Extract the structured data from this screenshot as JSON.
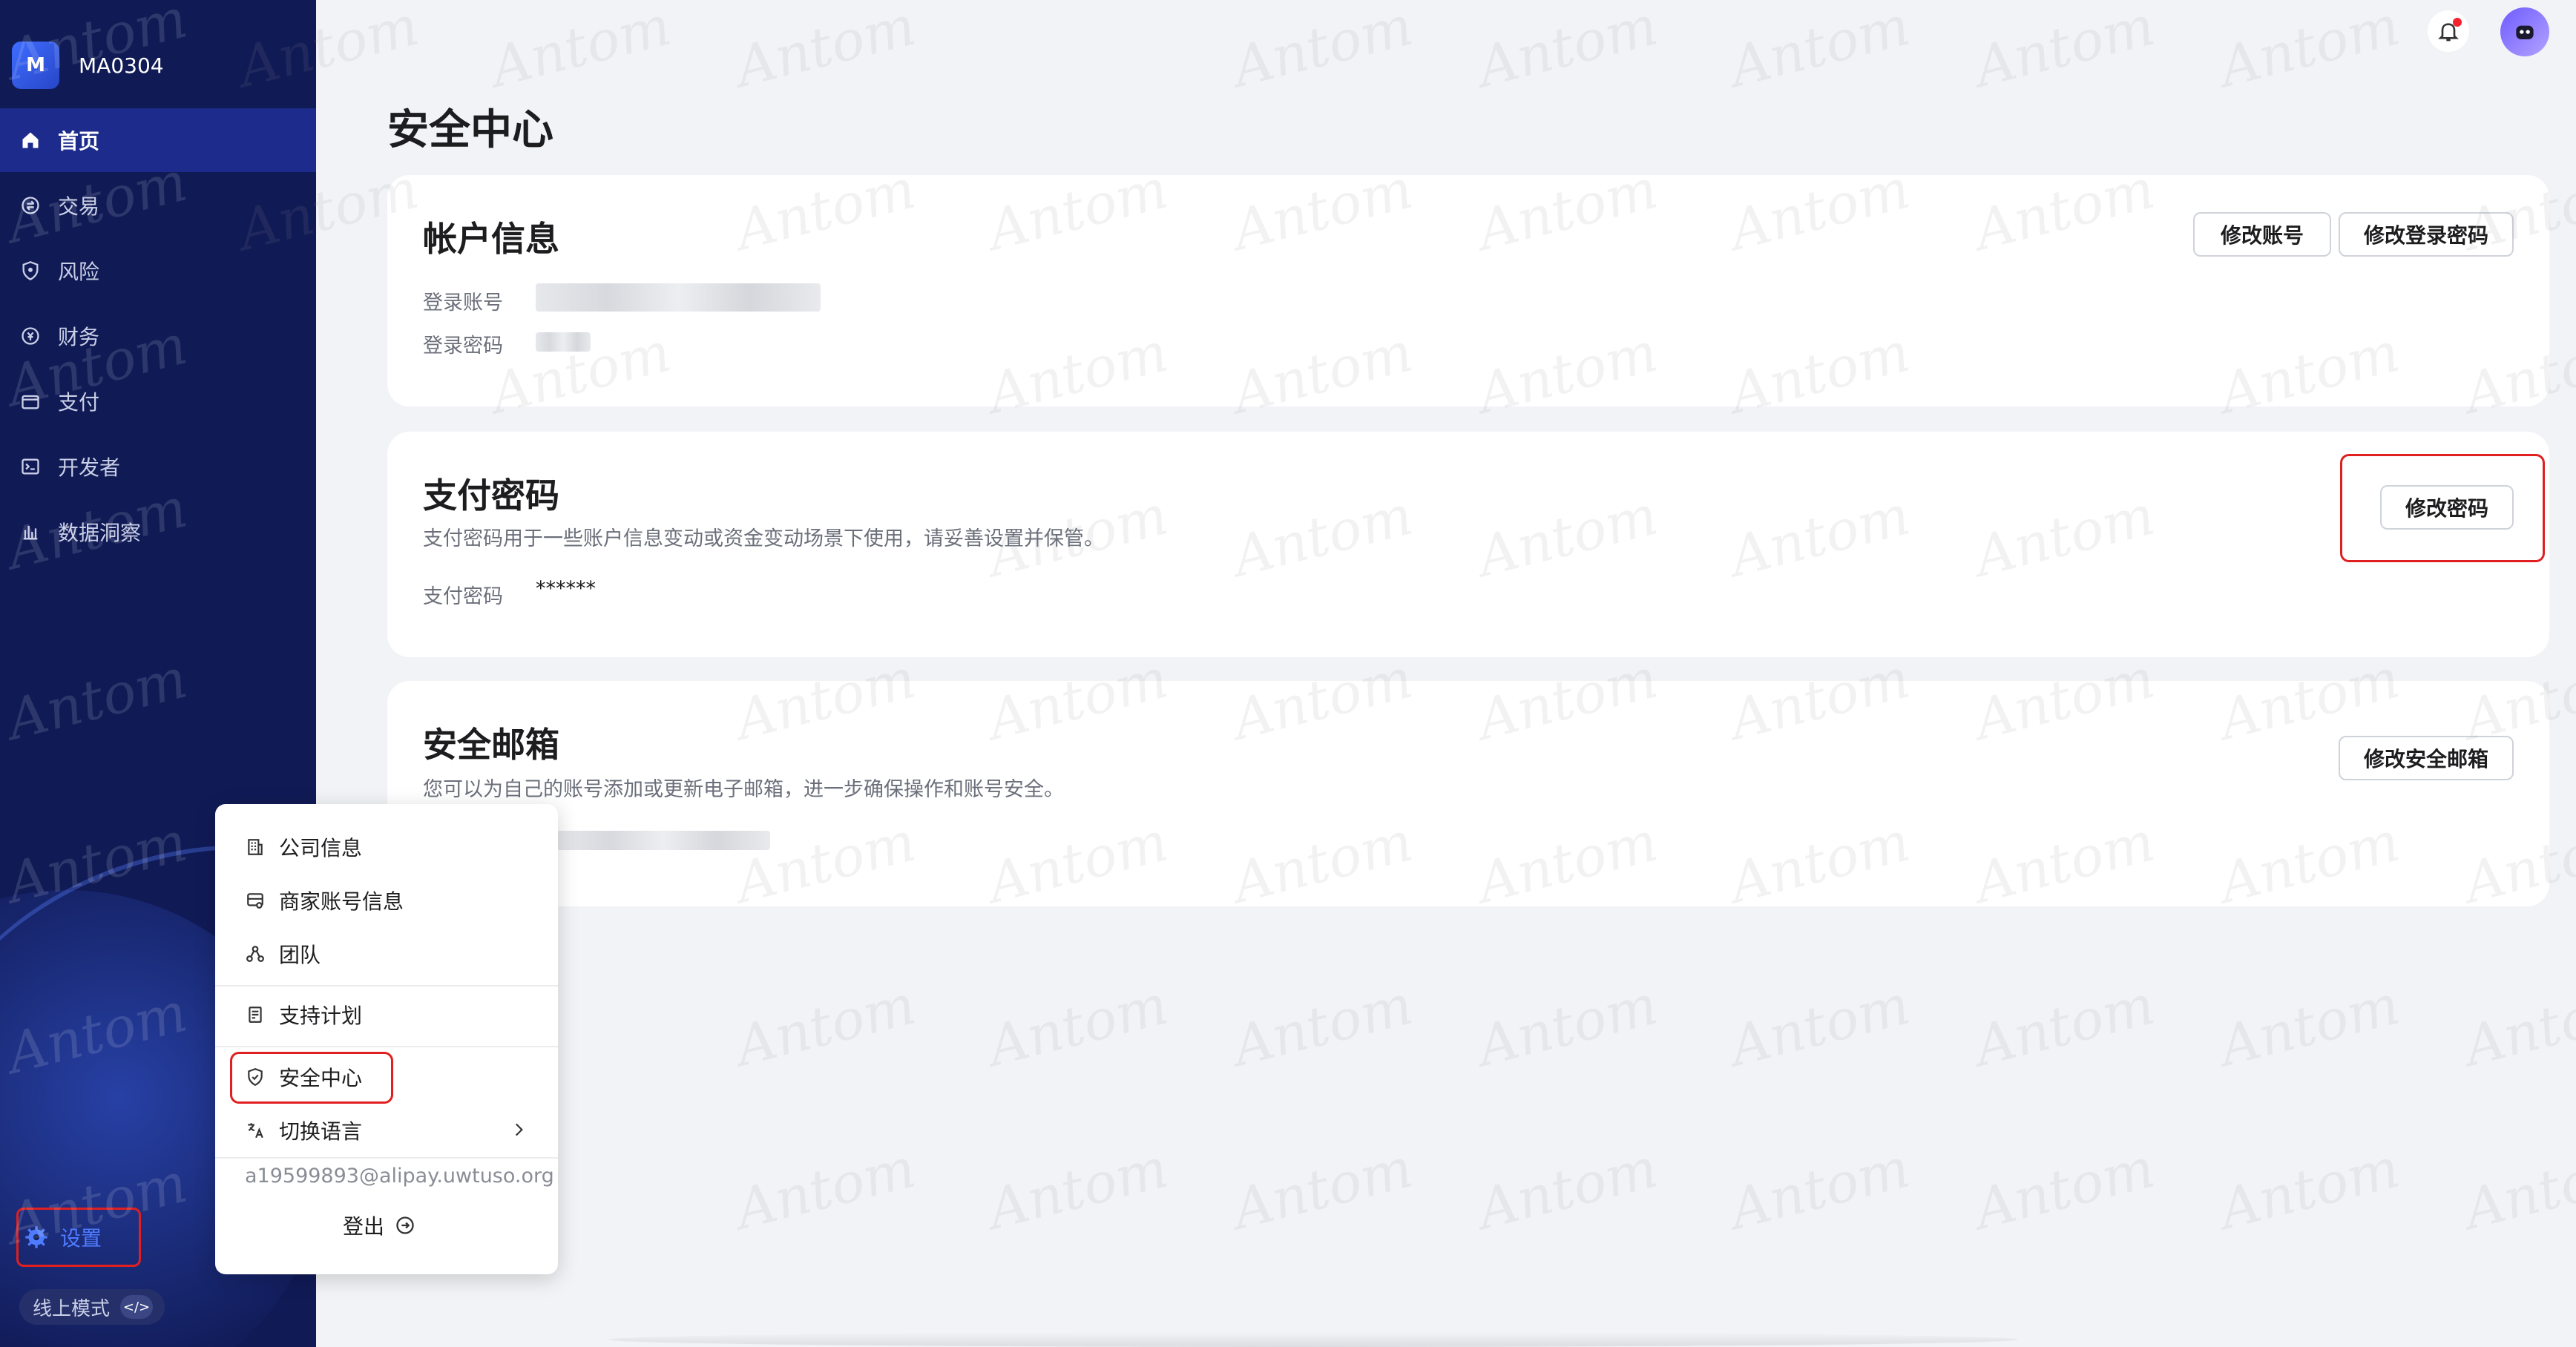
{
  "sidebar": {
    "brand_logo": "M",
    "brand_name": "MA0304",
    "nav": [
      {
        "label": "首页",
        "icon": "home-icon",
        "active": true
      },
      {
        "label": "交易",
        "icon": "transaction-icon"
      },
      {
        "label": "风险",
        "icon": "shield-icon"
      },
      {
        "label": "财务",
        "icon": "finance-icon"
      },
      {
        "label": "支付",
        "icon": "wallet-icon"
      },
      {
        "label": "开发者",
        "icon": "terminal-icon"
      },
      {
        "label": "数据洞察",
        "icon": "bar-chart-icon"
      }
    ],
    "settings_label": "设置",
    "mode_label": "线上模式",
    "mode_code": "</>"
  },
  "header": {
    "page_title": "安全中心"
  },
  "account_card": {
    "title": "帐户信息",
    "login_account_label": "登录账号",
    "login_password_label": "登录密码",
    "btn_change_account": "修改账号",
    "btn_change_login_password": "修改登录密码"
  },
  "payment_card": {
    "title": "支付密码",
    "description": "支付密码用于一些账户信息变动或资金变动场景下使用，请妥善设置并保管。",
    "password_label": "支付密码",
    "password_value": "******",
    "btn_change_password": "修改密码"
  },
  "email_card": {
    "title": "安全邮箱",
    "description": "您可以为自己的账号添加或更新电子邮箱，进一步确保操作和账号安全。",
    "btn_change_email": "修改安全邮箱"
  },
  "settings_menu": {
    "items": [
      {
        "label": "公司信息",
        "icon": "building-icon"
      },
      {
        "label": "商家账号信息",
        "icon": "merchant-account-icon"
      },
      {
        "label": "团队",
        "icon": "team-icon"
      },
      {
        "label": "支持计划",
        "icon": "document-icon"
      },
      {
        "label": "安全中心",
        "icon": "shield-check-icon",
        "highlighted": true
      },
      {
        "label": "切换语言",
        "icon": "translate-icon"
      }
    ],
    "email": "a19599893@alipay.uwtuso.org",
    "logout_label": "登出"
  },
  "watermark": "Antom",
  "colors": {
    "sidebar_bg": "#101a55",
    "sidebar_active": "#1d2c8c",
    "accent_blue": "#4f7cff",
    "highlight_red": "#e02020",
    "page_bg": "#f2f3f6"
  }
}
